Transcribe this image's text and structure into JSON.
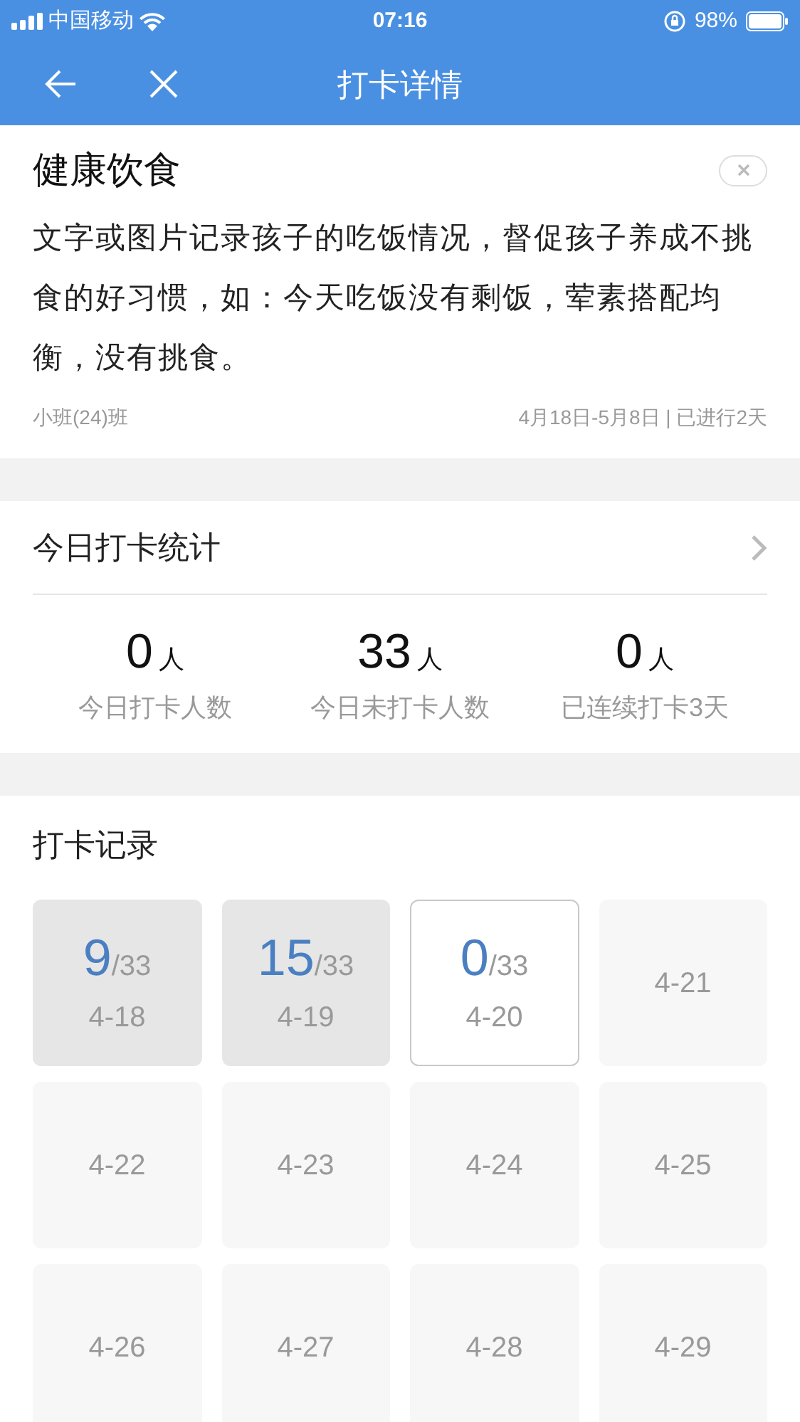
{
  "status_bar": {
    "carrier": "中国移动",
    "time": "07:16",
    "battery": "98%"
  },
  "nav": {
    "title": "打卡详情"
  },
  "task": {
    "title": "健康饮食",
    "description": "文字或图片记录孩子的吃饭情况，督促孩子养成不挑食的好习惯，如：今天吃饭没有剩饭，荤素搭配均衡，没有挑食。",
    "class_name": "小班(24)班",
    "period": "4月18日-5月8日 | 已进行2天"
  },
  "stats": {
    "title": "今日打卡统计",
    "items": [
      {
        "value": "0",
        "unit": "人",
        "label": "今日打卡人数"
      },
      {
        "value": "33",
        "unit": "人",
        "label": "今日未打卡人数"
      },
      {
        "value": "0",
        "unit": "人",
        "label": "已连续打卡3天"
      }
    ]
  },
  "records": {
    "title": "打卡记录",
    "days": [
      {
        "kind": "past",
        "count": "9",
        "total": "/33",
        "date": "4-18"
      },
      {
        "kind": "past",
        "count": "15",
        "total": "/33",
        "date": "4-19"
      },
      {
        "kind": "today",
        "count": "0",
        "total": "/33",
        "date": "4-20"
      },
      {
        "kind": "future",
        "date": "4-21"
      },
      {
        "kind": "future",
        "date": "4-22"
      },
      {
        "kind": "future",
        "date": "4-23"
      },
      {
        "kind": "future",
        "date": "4-24"
      },
      {
        "kind": "future",
        "date": "4-25"
      },
      {
        "kind": "future",
        "date": "4-26"
      },
      {
        "kind": "future",
        "date": "4-27"
      },
      {
        "kind": "future",
        "date": "4-28"
      },
      {
        "kind": "future",
        "date": "4-29"
      }
    ]
  }
}
